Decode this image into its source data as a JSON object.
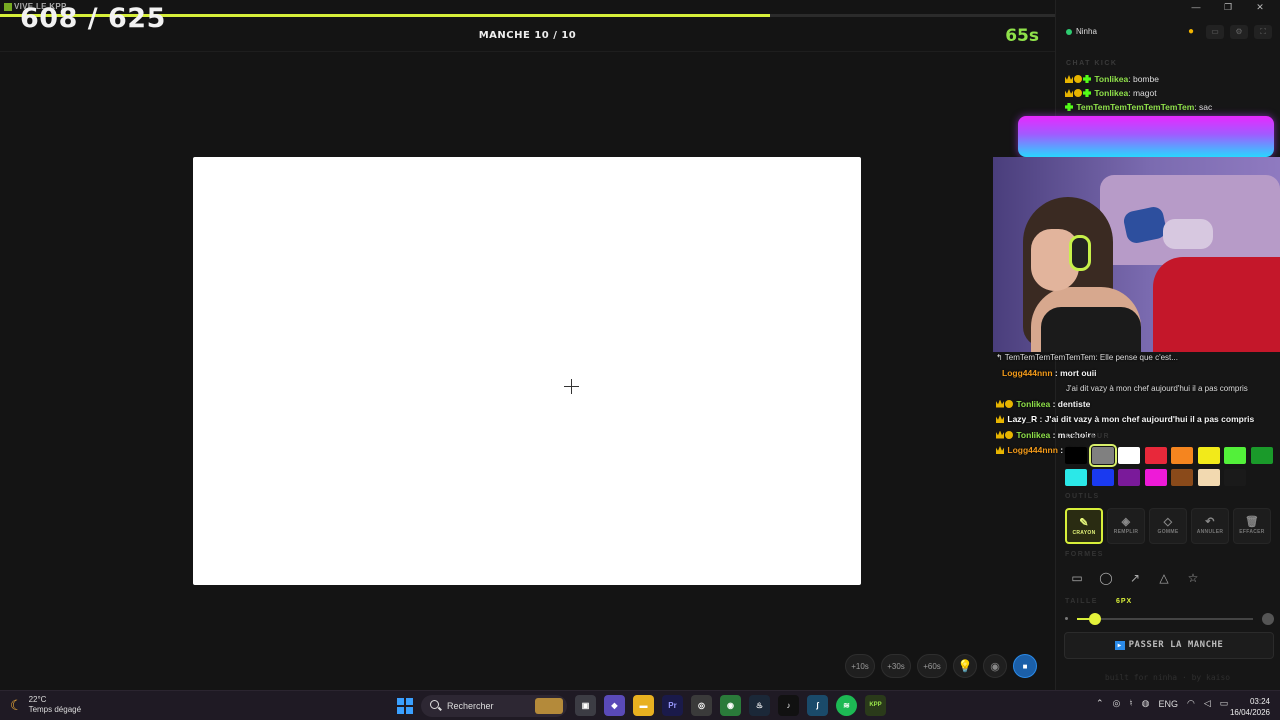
{
  "app": {
    "title": "VIVE LE KPP"
  },
  "header": {
    "score": "608 / 625",
    "round": "MANCHE 10 / 10",
    "timer": "65s",
    "progress_fraction": 0.73
  },
  "time_buttons": [
    "+10s",
    "+30s",
    "+60s"
  ],
  "panel": {
    "username": "Ninha",
    "chat_title": "CHAT KICK",
    "chat": [
      {
        "user": "Tonlikea",
        "text": "bombe"
      },
      {
        "user": "Tonlikea",
        "text": "magot"
      },
      {
        "user": "TemTemTemTemTemTemTem",
        "text": "sac"
      }
    ]
  },
  "overlay": {
    "lines": [
      {
        "user": "TemTemTemTemTemTem:",
        "text": "Elle pense que c'est..."
      },
      {
        "user": "Logg444nnn",
        "text": "mort ouii"
      },
      {
        "user": "",
        "text": "J'ai dit vazy à mon chef aujourd'hui il a pas compris"
      },
      {
        "user": "Tonlikea",
        "text": "dentiste"
      },
      {
        "user": "Lazy_R",
        "text": "J'ai dit vazy à mon chef aujourd'hui il a pas compris"
      },
      {
        "user": "Tonlikea",
        "text": "machoire"
      },
      {
        "user": "Logg444nnn",
        "text": "dent"
      }
    ]
  },
  "tools_section": {
    "colors_label": "COULEUR",
    "colors": [
      "#000000",
      "#808080",
      "#ffffff",
      "#e8283a",
      "#f5851f",
      "#f2ea1a",
      "#53f03a",
      "#1a9a2a",
      "#2be8e8",
      "#1a3af0",
      "#7a1a9a",
      "#ee1ad8",
      "#8a4a1a",
      "#f2d9b0",
      "#1a1a1a"
    ],
    "selected_color": "#808080",
    "tools_label": "OUTILS",
    "tools": [
      {
        "label": "CRAYON",
        "icon": "pencil-icon"
      },
      {
        "label": "REMPLIR",
        "icon": "fill-icon"
      },
      {
        "label": "GOMME",
        "icon": "eraser-icon"
      },
      {
        "label": "ANNULER",
        "icon": "undo-icon"
      },
      {
        "label": "EFFACER",
        "icon": "trash-icon"
      }
    ],
    "shapes_label": "FORMES",
    "size_label": "TAILLE",
    "size_value": "6PX",
    "size_fraction": 0.1,
    "skip_label": "PASSER LA MANCHE",
    "credit": "built for ninha · by kaiso"
  },
  "taskbar": {
    "weather_temp": "22°C",
    "weather_desc": "Temps dégagé",
    "search_placeholder": "Rechercher",
    "lang": "ENG",
    "time": "03:24",
    "date": "16/04/2026"
  }
}
